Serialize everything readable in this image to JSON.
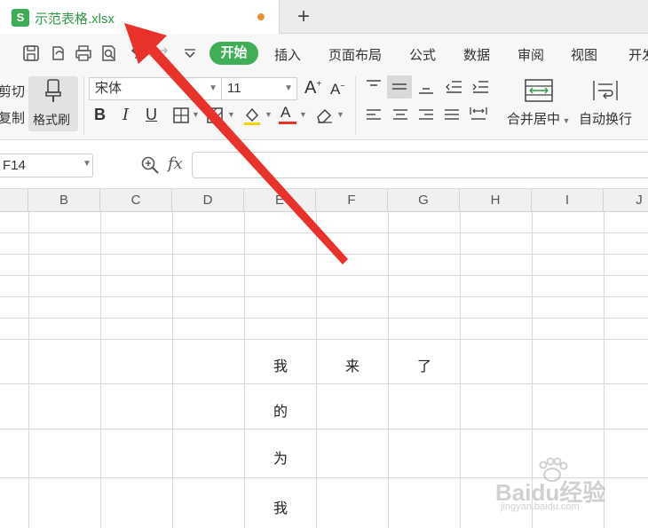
{
  "tab": {
    "file_name": "示范表格.xlsx",
    "file_icon_letter": "S",
    "new_tab": "+"
  },
  "menu": {
    "items": [
      "开始",
      "插入",
      "页面布局",
      "公式",
      "数据",
      "审阅",
      "视图",
      "开发"
    ]
  },
  "ribbon": {
    "cut": "剪切",
    "copy": "复制",
    "format_painter": "格式刷",
    "font_name": "宋体",
    "font_size": "11",
    "merge_center": "合并居中",
    "wrap_text": "自动换行",
    "bold": "B",
    "italic": "I",
    "underline": "U",
    "font_color_letter": "A",
    "grow_font": "A",
    "shrink_font": "A"
  },
  "formula_bar": {
    "cell_ref": "F14",
    "fx": "fx",
    "value": ""
  },
  "columns": [
    "B",
    "C",
    "D",
    "E",
    "F",
    "G",
    "H",
    "I",
    "J"
  ],
  "cells": {
    "e1": "我",
    "f1": "来",
    "g1": "了",
    "e2": "的",
    "e3": "为",
    "e4": "我"
  },
  "watermark": {
    "brand": "Baidu经验",
    "url": "jingyan.baidu.com"
  },
  "colors": {
    "accent_green": "#3fae56",
    "annotation_red": "#e8322b",
    "modified_dot": "#e8913b"
  }
}
